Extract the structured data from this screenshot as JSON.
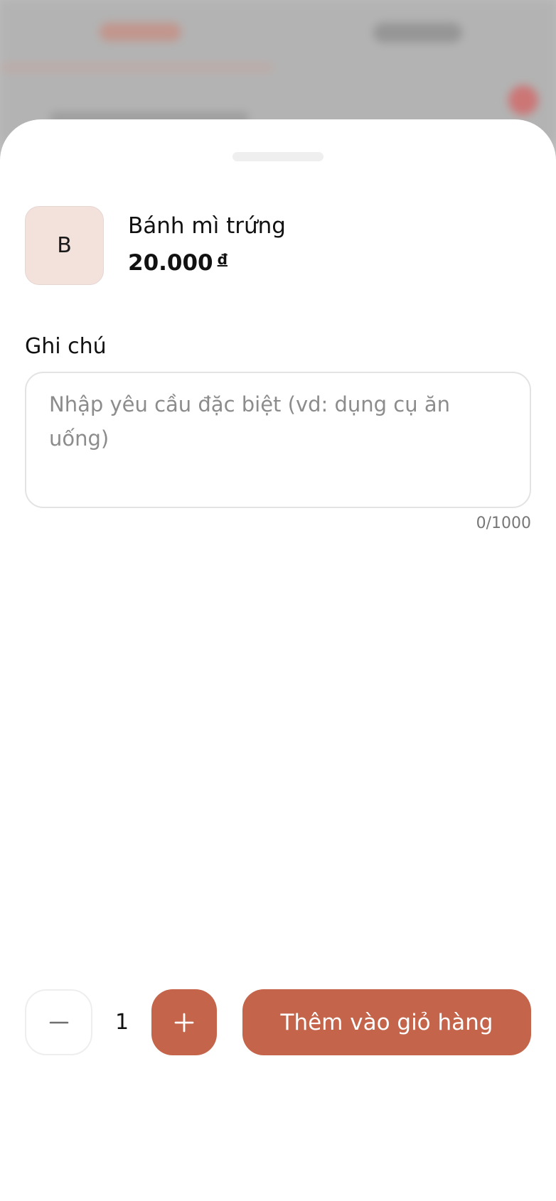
{
  "product": {
    "thumb_letter": "B",
    "name": "Bánh mì trứng",
    "price": "20.000",
    "currency": "đ"
  },
  "note": {
    "label": "Ghi chú",
    "value": "",
    "placeholder": "Nhập yêu cầu đặc biệt (vd: dụng cụ ăn uống)",
    "counter": "0/1000"
  },
  "quantity": {
    "value": "1",
    "minus_icon": "minus-icon",
    "plus_icon": "plus-icon"
  },
  "actions": {
    "add_to_cart_label": "Thêm vào giỏ hàng"
  },
  "colors": {
    "accent": "#c4644a",
    "thumb_bg": "#f3e1dc"
  }
}
